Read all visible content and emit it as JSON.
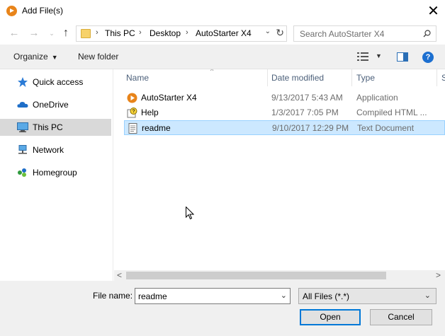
{
  "window": {
    "title": "Add File(s)",
    "close_glyph": "✕",
    "accent": "#0078d7"
  },
  "address": {
    "back_glyph": "←",
    "forward_glyph": "→",
    "recent_glyph": "⌄",
    "up_glyph": "↑",
    "breadcrumbs": [
      "This PC",
      "Desktop",
      "AutoStarter X4"
    ],
    "separator": "›",
    "dropdown_glyph": "⌄",
    "refresh_glyph": "↻",
    "search_placeholder": "Search AutoStarter X4"
  },
  "toolbar": {
    "organize_label": "Organize",
    "organize_caret": "▼",
    "new_folder_label": "New folder",
    "view_caret": "▼",
    "help_glyph": "?"
  },
  "navpane": {
    "items": [
      {
        "label": "Quick access",
        "icon": "star-icon",
        "selected": false
      },
      {
        "label": "OneDrive",
        "icon": "cloud-icon",
        "selected": false
      },
      {
        "label": "This PC",
        "icon": "computer-icon",
        "selected": true
      },
      {
        "label": "Network",
        "icon": "network-icon",
        "selected": false
      },
      {
        "label": "Homegroup",
        "icon": "homegroup-icon",
        "selected": false
      }
    ]
  },
  "filelist": {
    "sort_glyph": "^",
    "columns": [
      "Name",
      "Date modified",
      "Type",
      "S"
    ],
    "rows": [
      {
        "name": "AutoStarter X4",
        "date": "9/13/2017 5:43 AM",
        "type": "Application",
        "icon": "app-icon",
        "selected": false
      },
      {
        "name": "Help",
        "date": "1/3/2017 7:05 PM",
        "type": "Compiled HTML ...",
        "icon": "help-file-icon",
        "selected": false
      },
      {
        "name": "readme",
        "date": "9/10/2017 12:29 PM",
        "type": "Text Document",
        "icon": "text-file-icon",
        "selected": true
      }
    ]
  },
  "scrollbar": {
    "left_glyph": "<",
    "right_glyph": ">"
  },
  "bottom": {
    "filename_label": "File name:",
    "filename_value": "readme",
    "dropdown_glyph": "⌄",
    "filter_value": "All Files (*.*)",
    "open_label": "Open",
    "cancel_label": "Cancel"
  }
}
